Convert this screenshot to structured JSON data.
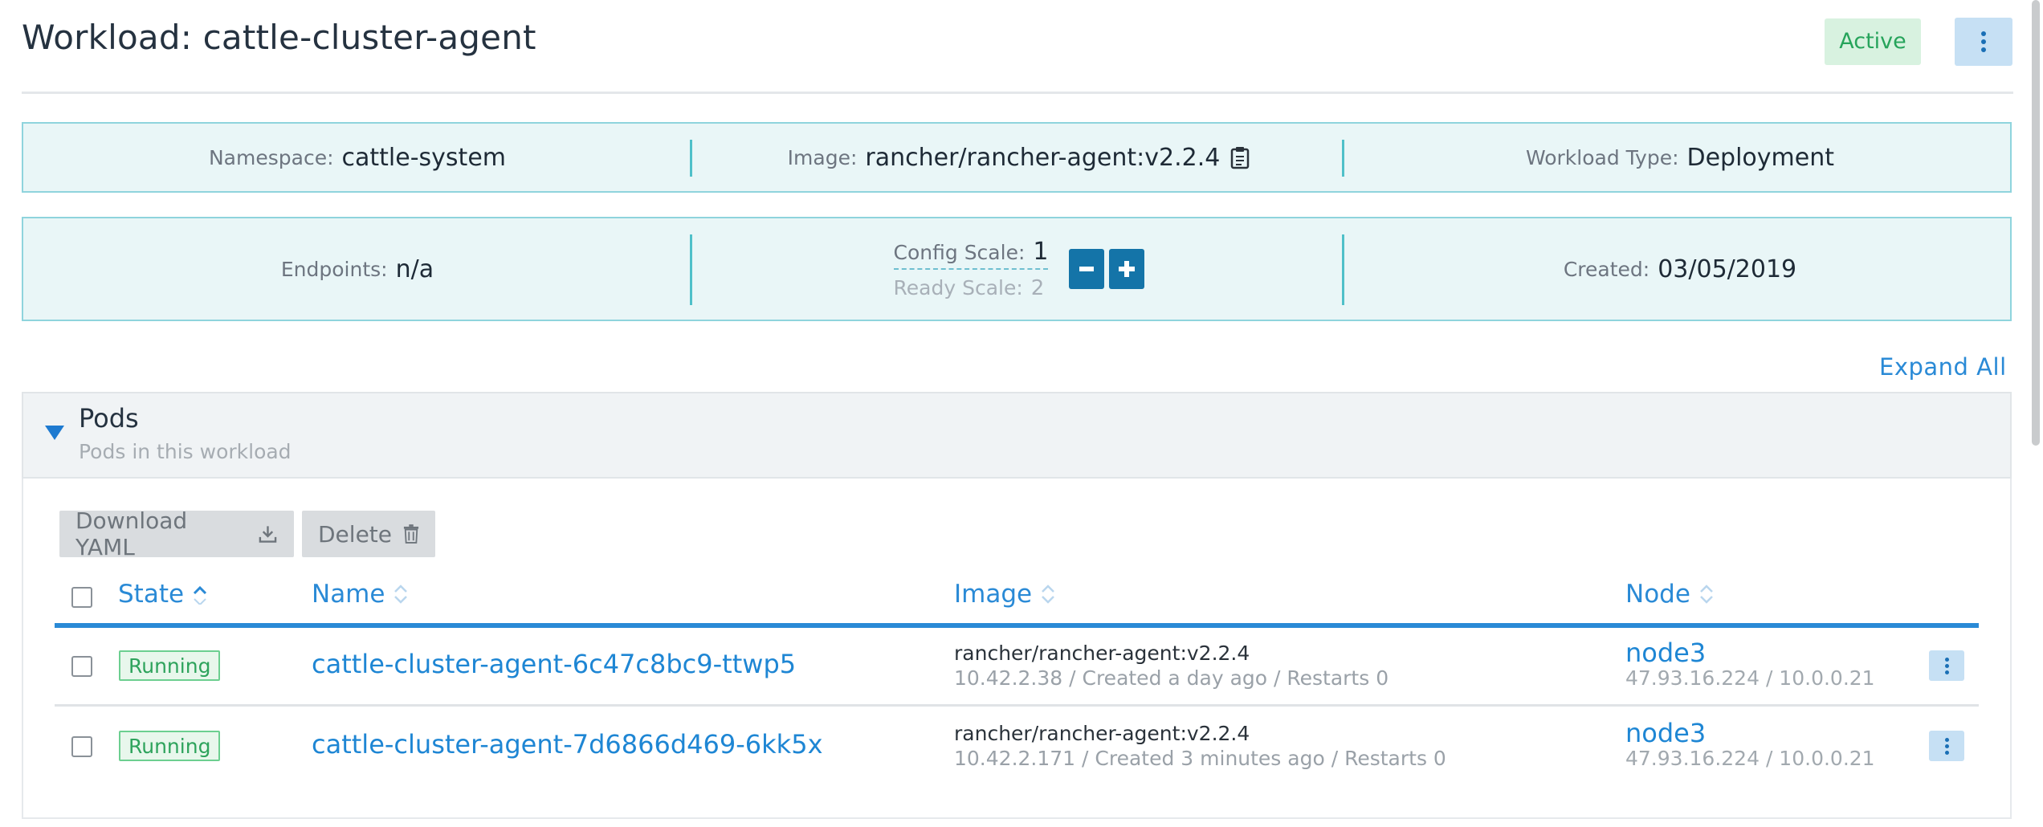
{
  "header": {
    "title": "Workload: cattle-cluster-agent",
    "status": "Active"
  },
  "info": {
    "namespace_label": "Namespace:",
    "namespace_value": "cattle-system",
    "image_label": "Image:",
    "image_value": "rancher/rancher-agent:v2.2.4",
    "workload_type_label": "Workload Type:",
    "workload_type_value": "Deployment",
    "endpoints_label": "Endpoints:",
    "endpoints_value": "n/a",
    "config_scale_label": "Config Scale:",
    "config_scale_value": "1",
    "ready_scale_label": "Ready Scale:",
    "ready_scale_value": "2",
    "created_label": "Created:",
    "created_value": "03/05/2019"
  },
  "expand_all": "Expand All",
  "pods": {
    "title": "Pods",
    "subtitle": "Pods in this workload",
    "download_yaml": "Download YAML",
    "delete": "Delete",
    "columns": {
      "state": "State",
      "name": "Name",
      "image": "Image",
      "node": "Node"
    },
    "rows": [
      {
        "state": "Running",
        "name": "cattle-cluster-agent-6c47c8bc9-ttwp5",
        "image": "rancher/rancher-agent:v2.2.4",
        "meta": "10.42.2.38 / Created a day ago / Restarts 0",
        "node": "node3",
        "ips": "47.93.16.224  /  10.0.0.21"
      },
      {
        "state": "Running",
        "name": "cattle-cluster-agent-7d6866d469-6kk5x",
        "image": "rancher/rancher-agent:v2.2.4",
        "meta": "10.42.2.171 / Created 3 minutes ago / Restarts 0",
        "node": "node3",
        "ips": "47.93.16.224  /  10.0.0.21"
      }
    ]
  },
  "colors": {
    "accent": "#2a8ad6",
    "info_bg": "#e9f6f7",
    "info_border": "#8fd4dd",
    "active_badge": "#26a45b",
    "scale_button": "#1474a8"
  }
}
